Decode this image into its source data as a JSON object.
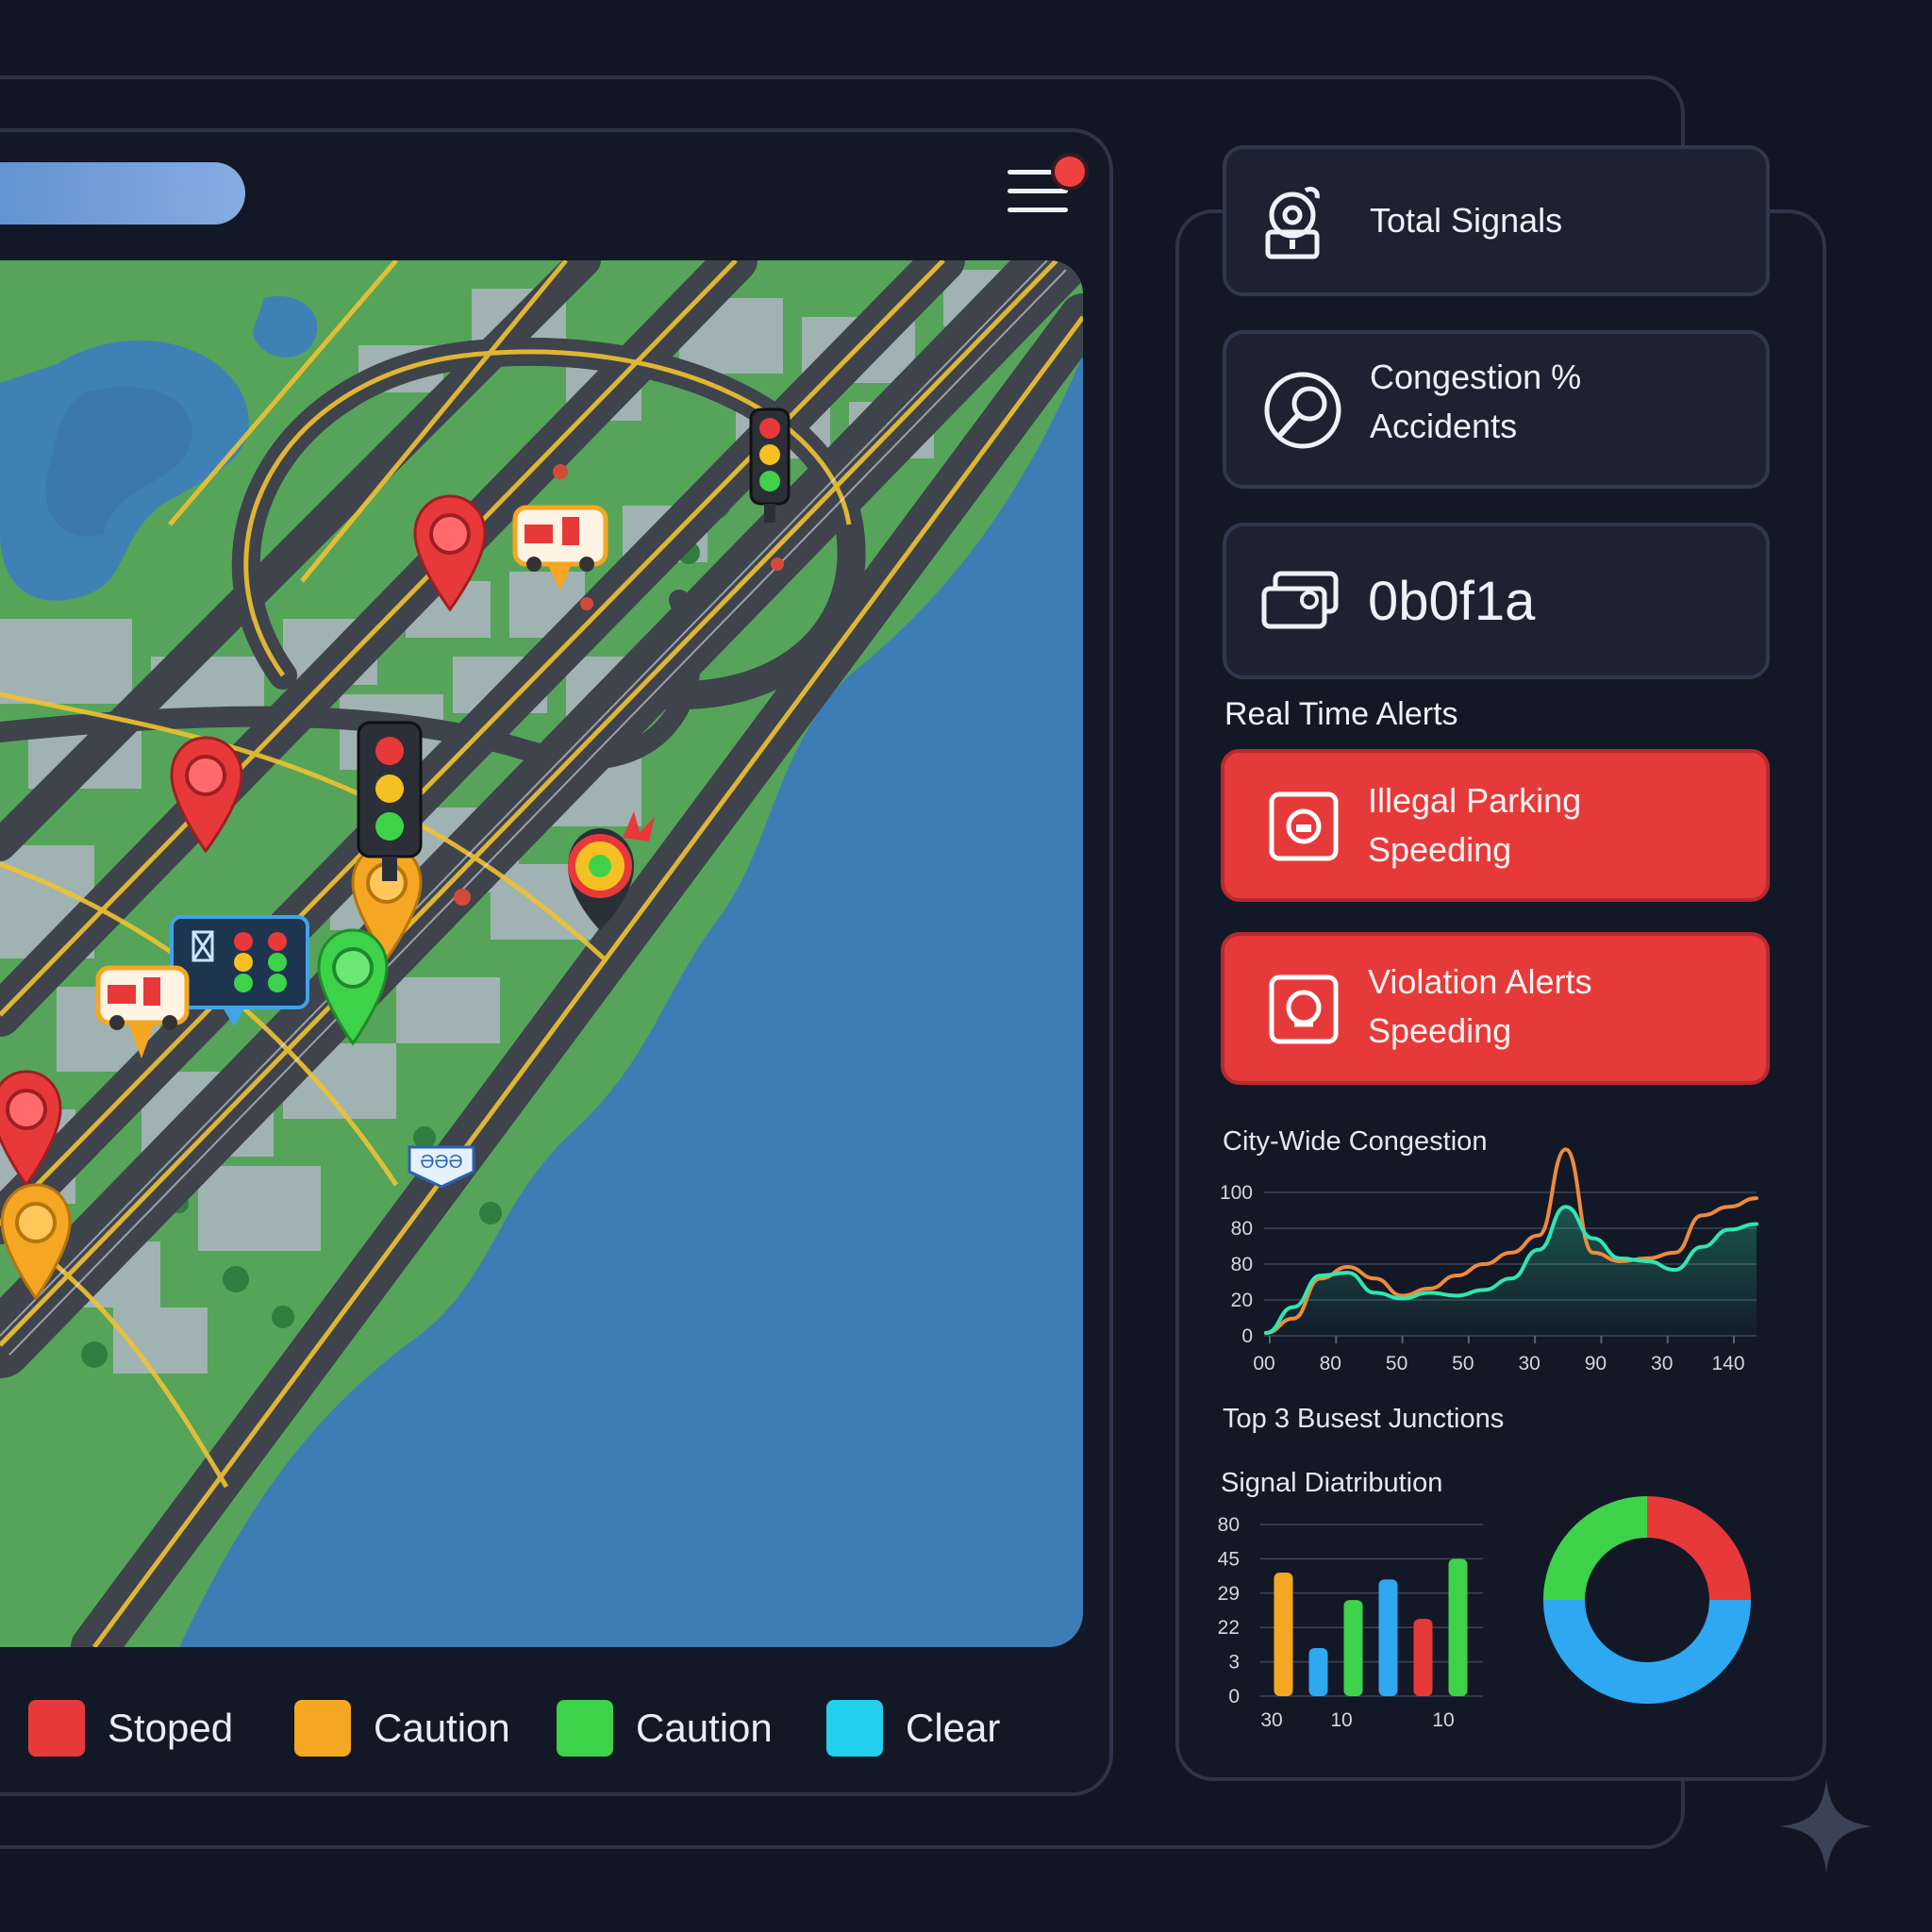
{
  "header": {
    "menu_label": "Menu",
    "notification": true
  },
  "legend": [
    {
      "label": "Stoped",
      "color": "#e8393a"
    },
    {
      "label": "Caution",
      "color": "#f5a623"
    },
    {
      "label": "Caution",
      "color": "#3ed24a"
    },
    {
      "label": "Clear",
      "color": "#22d0ee"
    }
  ],
  "map": {
    "markers": [
      {
        "kind": "pin",
        "color": "#e8393a"
      },
      {
        "kind": "pin",
        "color": "#e8393a"
      },
      {
        "kind": "pin",
        "color": "#e8393a"
      },
      {
        "kind": "pin",
        "color": "#f5a623"
      },
      {
        "kind": "pin",
        "color": "#f5a623"
      },
      {
        "kind": "pin",
        "color": "#3ed24a"
      },
      {
        "kind": "traffic-light"
      },
      {
        "kind": "traffic-light"
      },
      {
        "kind": "ambulance"
      },
      {
        "kind": "ambulance"
      },
      {
        "kind": "accident"
      },
      {
        "kind": "signal-board"
      },
      {
        "kind": "tag",
        "text": "ƏƏƏ"
      }
    ]
  },
  "stats": {
    "total_signals_label": "Total Signals",
    "congestion_label": "Congestion %",
    "accidents_label": "Accidents",
    "value_label": "0b0f1a"
  },
  "alerts": {
    "title": "Real Time Alerts",
    "items": [
      {
        "title": "Illegal Parking",
        "subtitle": "Speeding"
      },
      {
        "title": "Violation Alerts",
        "subtitle": "Speeding"
      }
    ]
  },
  "congestion_chart": {
    "title": "City-Wide Congestion"
  },
  "busiest": {
    "title": "Top 3 Busest Junctions"
  },
  "signal_chart": {
    "title": "Signal Diatribution"
  },
  "chart_data": [
    {
      "type": "area",
      "title": "City-Wide Congestion",
      "y_tick_labels": [
        "100",
        "80",
        "80",
        "20",
        "0"
      ],
      "x_tick_labels": [
        "00",
        "80",
        "50",
        "50",
        "30",
        "90",
        "30",
        "140"
      ],
      "ylim": [
        0,
        100
      ],
      "grid": true,
      "series": [
        {
          "color": "#f08a3c",
          "values": [
            2,
            12,
            40,
            48,
            40,
            28,
            33,
            42,
            50,
            58,
            70,
            130,
            58,
            52,
            54,
            58,
            84,
            90,
            96
          ]
        },
        {
          "color": "#2ee8b0",
          "values": [
            2,
            20,
            42,
            44,
            30,
            26,
            30,
            28,
            32,
            40,
            60,
            90,
            68,
            54,
            52,
            46,
            62,
            74,
            78
          ]
        }
      ]
    },
    {
      "type": "bar",
      "title": "Signal Diatribution",
      "y_tick_labels": [
        "80",
        "45",
        "29",
        "22",
        "3",
        "0"
      ],
      "x_tick_labels": [
        "30",
        "10",
        "10"
      ],
      "ylim": [
        0,
        100
      ],
      "bars": [
        {
          "value": 72,
          "color": "#f5a623"
        },
        {
          "value": 28,
          "color": "#2ea8f0"
        },
        {
          "value": 56,
          "color": "#3ed24a"
        },
        {
          "value": 68,
          "color": "#2ea8f0"
        },
        {
          "value": 45,
          "color": "#e8393a"
        },
        {
          "value": 80,
          "color": "#3ed24a"
        }
      ]
    },
    {
      "type": "pie",
      "style": "donut",
      "slices": [
        {
          "value": 25,
          "color": "#e8393a"
        },
        {
          "value": 50,
          "color": "#2ea8f0"
        },
        {
          "value": 25,
          "color": "#3ed24a"
        }
      ]
    }
  ]
}
